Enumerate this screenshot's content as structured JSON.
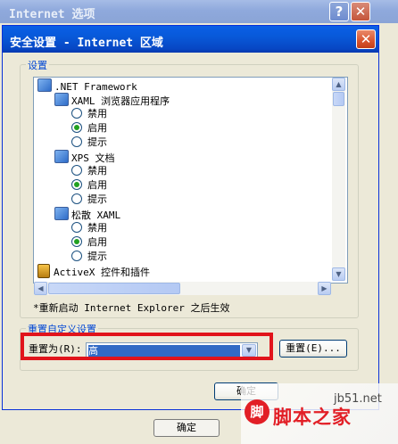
{
  "back_window": {
    "title": "Internet 选项",
    "help_glyph": "?",
    "close_glyph": "✕",
    "bottom_ok_label": "确定"
  },
  "dialog": {
    "title": "安全设置 - Internet 区域",
    "close_glyph": "✕",
    "settings_group_label": "设置",
    "tree": [
      {
        "kind": "category",
        "label": ".NET Framework",
        "indent": 0
      },
      {
        "kind": "category",
        "label": "XAML 浏览器应用程序",
        "indent": 1
      },
      {
        "kind": "option",
        "label": "禁用",
        "selected": false,
        "indent": 2
      },
      {
        "kind": "option",
        "label": "启用",
        "selected": true,
        "indent": 2
      },
      {
        "kind": "option",
        "label": "提示",
        "selected": false,
        "indent": 2
      },
      {
        "kind": "category",
        "label": "XPS 文档",
        "indent": 1
      },
      {
        "kind": "option",
        "label": "禁用",
        "selected": false,
        "indent": 2
      },
      {
        "kind": "option",
        "label": "启用",
        "selected": true,
        "indent": 2
      },
      {
        "kind": "option",
        "label": "提示",
        "selected": false,
        "indent": 2
      },
      {
        "kind": "category",
        "label": "松散 XAML",
        "indent": 1
      },
      {
        "kind": "option",
        "label": "禁用",
        "selected": false,
        "indent": 2
      },
      {
        "kind": "option",
        "label": "启用",
        "selected": true,
        "indent": 2
      },
      {
        "kind": "option",
        "label": "提示",
        "selected": false,
        "indent": 2
      },
      {
        "kind": "category-gear",
        "label": "ActiveX 控件和插件",
        "indent": 0
      }
    ],
    "restart_note": "*重新启动 Internet Explorer 之后生效",
    "reset_group_label": "重置自定义设置",
    "reset_to_label": "重置为(R):",
    "reset_level_value": "高",
    "reset_button_label": "重置(E)...",
    "ok_label": "确定"
  },
  "scroll_icons": {
    "up": "▲",
    "down": "▼",
    "left": "◀",
    "right": "▶"
  },
  "watermark": {
    "url": "jb51.net",
    "logo_glyph": "脚",
    "name": "脚本之家"
  }
}
